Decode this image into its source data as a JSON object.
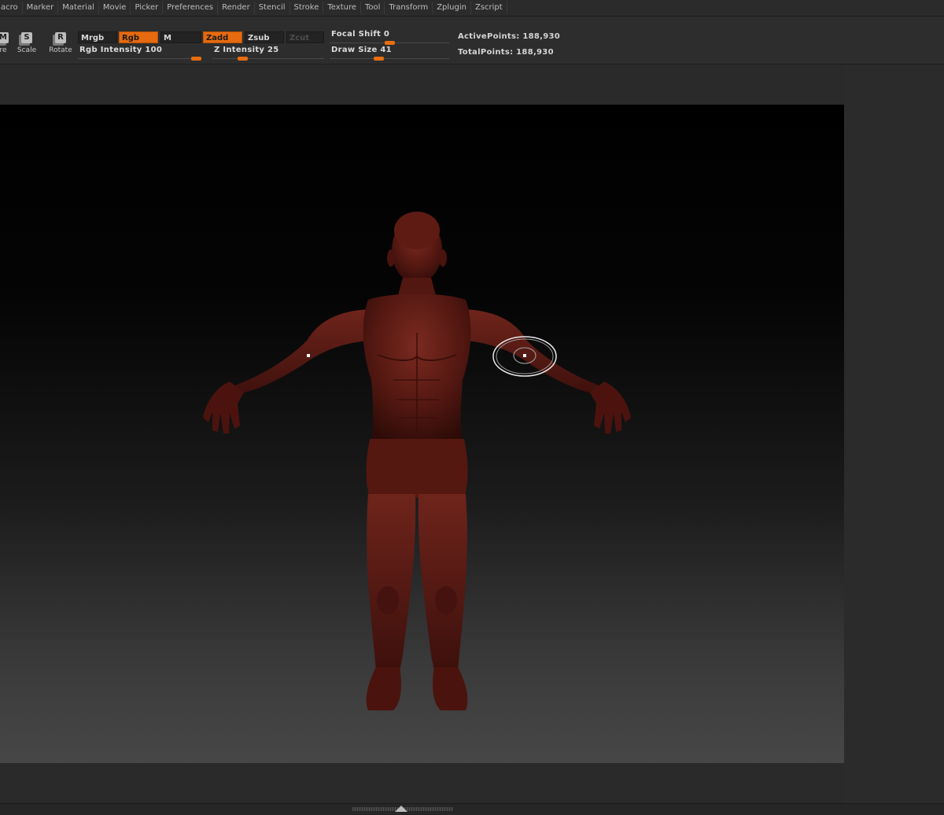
{
  "menu": [
    "acro",
    "Marker",
    "Material",
    "Movie",
    "Picker",
    "Preferences",
    "Render",
    "Stencil",
    "Stroke",
    "Texture",
    "Tool",
    "Transform",
    "Zplugin",
    "Zscript"
  ],
  "tools": {
    "move": {
      "icon": "M",
      "label": "re"
    },
    "scale": {
      "icon": "S",
      "label": "Scale"
    },
    "rotate": {
      "icon": "R",
      "label": "Rotate"
    }
  },
  "buttons": {
    "mrgb": "Mrgb",
    "rgb": "Rgb",
    "m": "M",
    "zadd": "Zadd",
    "zsub": "Zsub",
    "zcut": "Zcut"
  },
  "sliders": {
    "rgb_intensity": {
      "label": "Rgb Intensity 100",
      "value": 100,
      "max": 100
    },
    "z_intensity": {
      "label": "Z Intensity 25",
      "value": 25,
      "max": 100
    },
    "focal_shift": {
      "label": "Focal Shift 0",
      "value": 0,
      "min": -100,
      "max": 100
    },
    "draw_size": {
      "label": "Draw Size 41",
      "value": 41,
      "max": 1000
    }
  },
  "stats": {
    "active_points": "ActivePoints: 188,930",
    "total_points": "TotalPoints: 188,930"
  },
  "colors": {
    "accent": "#e66a0f",
    "model": "#5a1a14",
    "panel": "#2d2d2d"
  }
}
